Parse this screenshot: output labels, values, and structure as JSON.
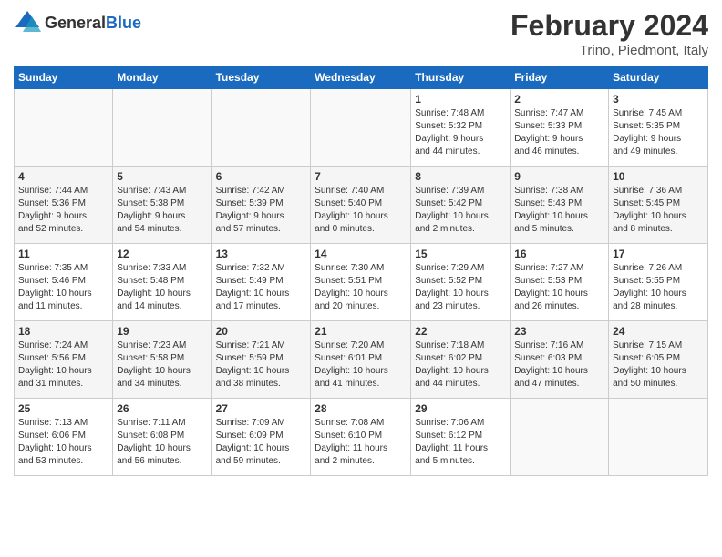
{
  "header": {
    "logo": {
      "general": "General",
      "blue": "Blue"
    },
    "title": "February 2024",
    "location": "Trino, Piedmont, Italy"
  },
  "columns": [
    "Sunday",
    "Monday",
    "Tuesday",
    "Wednesday",
    "Thursday",
    "Friday",
    "Saturday"
  ],
  "weeks": [
    [
      {
        "day": "",
        "info": ""
      },
      {
        "day": "",
        "info": ""
      },
      {
        "day": "",
        "info": ""
      },
      {
        "day": "",
        "info": ""
      },
      {
        "day": "1",
        "info": "Sunrise: 7:48 AM\nSunset: 5:32 PM\nDaylight: 9 hours\nand 44 minutes."
      },
      {
        "day": "2",
        "info": "Sunrise: 7:47 AM\nSunset: 5:33 PM\nDaylight: 9 hours\nand 46 minutes."
      },
      {
        "day": "3",
        "info": "Sunrise: 7:45 AM\nSunset: 5:35 PM\nDaylight: 9 hours\nand 49 minutes."
      }
    ],
    [
      {
        "day": "4",
        "info": "Sunrise: 7:44 AM\nSunset: 5:36 PM\nDaylight: 9 hours\nand 52 minutes."
      },
      {
        "day": "5",
        "info": "Sunrise: 7:43 AM\nSunset: 5:38 PM\nDaylight: 9 hours\nand 54 minutes."
      },
      {
        "day": "6",
        "info": "Sunrise: 7:42 AM\nSunset: 5:39 PM\nDaylight: 9 hours\nand 57 minutes."
      },
      {
        "day": "7",
        "info": "Sunrise: 7:40 AM\nSunset: 5:40 PM\nDaylight: 10 hours\nand 0 minutes."
      },
      {
        "day": "8",
        "info": "Sunrise: 7:39 AM\nSunset: 5:42 PM\nDaylight: 10 hours\nand 2 minutes."
      },
      {
        "day": "9",
        "info": "Sunrise: 7:38 AM\nSunset: 5:43 PM\nDaylight: 10 hours\nand 5 minutes."
      },
      {
        "day": "10",
        "info": "Sunrise: 7:36 AM\nSunset: 5:45 PM\nDaylight: 10 hours\nand 8 minutes."
      }
    ],
    [
      {
        "day": "11",
        "info": "Sunrise: 7:35 AM\nSunset: 5:46 PM\nDaylight: 10 hours\nand 11 minutes."
      },
      {
        "day": "12",
        "info": "Sunrise: 7:33 AM\nSunset: 5:48 PM\nDaylight: 10 hours\nand 14 minutes."
      },
      {
        "day": "13",
        "info": "Sunrise: 7:32 AM\nSunset: 5:49 PM\nDaylight: 10 hours\nand 17 minutes."
      },
      {
        "day": "14",
        "info": "Sunrise: 7:30 AM\nSunset: 5:51 PM\nDaylight: 10 hours\nand 20 minutes."
      },
      {
        "day": "15",
        "info": "Sunrise: 7:29 AM\nSunset: 5:52 PM\nDaylight: 10 hours\nand 23 minutes."
      },
      {
        "day": "16",
        "info": "Sunrise: 7:27 AM\nSunset: 5:53 PM\nDaylight: 10 hours\nand 26 minutes."
      },
      {
        "day": "17",
        "info": "Sunrise: 7:26 AM\nSunset: 5:55 PM\nDaylight: 10 hours\nand 28 minutes."
      }
    ],
    [
      {
        "day": "18",
        "info": "Sunrise: 7:24 AM\nSunset: 5:56 PM\nDaylight: 10 hours\nand 31 minutes."
      },
      {
        "day": "19",
        "info": "Sunrise: 7:23 AM\nSunset: 5:58 PM\nDaylight: 10 hours\nand 34 minutes."
      },
      {
        "day": "20",
        "info": "Sunrise: 7:21 AM\nSunset: 5:59 PM\nDaylight: 10 hours\nand 38 minutes."
      },
      {
        "day": "21",
        "info": "Sunrise: 7:20 AM\nSunset: 6:01 PM\nDaylight: 10 hours\nand 41 minutes."
      },
      {
        "day": "22",
        "info": "Sunrise: 7:18 AM\nSunset: 6:02 PM\nDaylight: 10 hours\nand 44 minutes."
      },
      {
        "day": "23",
        "info": "Sunrise: 7:16 AM\nSunset: 6:03 PM\nDaylight: 10 hours\nand 47 minutes."
      },
      {
        "day": "24",
        "info": "Sunrise: 7:15 AM\nSunset: 6:05 PM\nDaylight: 10 hours\nand 50 minutes."
      }
    ],
    [
      {
        "day": "25",
        "info": "Sunrise: 7:13 AM\nSunset: 6:06 PM\nDaylight: 10 hours\nand 53 minutes."
      },
      {
        "day": "26",
        "info": "Sunrise: 7:11 AM\nSunset: 6:08 PM\nDaylight: 10 hours\nand 56 minutes."
      },
      {
        "day": "27",
        "info": "Sunrise: 7:09 AM\nSunset: 6:09 PM\nDaylight: 10 hours\nand 59 minutes."
      },
      {
        "day": "28",
        "info": "Sunrise: 7:08 AM\nSunset: 6:10 PM\nDaylight: 11 hours\nand 2 minutes."
      },
      {
        "day": "29",
        "info": "Sunrise: 7:06 AM\nSunset: 6:12 PM\nDaylight: 11 hours\nand 5 minutes."
      },
      {
        "day": "",
        "info": ""
      },
      {
        "day": "",
        "info": ""
      }
    ]
  ]
}
